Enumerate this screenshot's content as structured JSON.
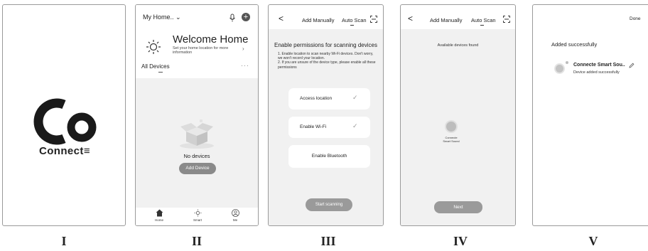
{
  "step_labels": [
    "I",
    "II",
    "III",
    "IV",
    "V"
  ],
  "splash": {
    "logo_letters": "Co",
    "brand": "Connect≡"
  },
  "home": {
    "home_selector": "My Home.. ⌄",
    "add_symbol": "+",
    "welcome_title": "Welcome Home",
    "welcome_sub": "Set your home location for more information",
    "chevron": "›",
    "all_devices": "All Devices",
    "more": "···",
    "no_devices": "No devices",
    "add_device_button": "Add Device",
    "nav": [
      {
        "label": "Home",
        "icon": "home-icon"
      },
      {
        "label": "Smart",
        "icon": "sun-icon"
      },
      {
        "label": "Me",
        "icon": "user-icon"
      }
    ]
  },
  "permissions": {
    "back": "<",
    "tab_manual": "Add Manually",
    "tab_auto": "Auto Scan",
    "title": "Enable permissions for scanning devices",
    "instruction_1": "1. Enable location to scan nearby Wi-Fi devices. Don't worry, we won't record your location.",
    "instruction_2": "2. If you are unsure of the device type, please enable all these permissions",
    "items": [
      {
        "label": "Access location",
        "check": "✓"
      },
      {
        "label": "Enable Wi-Fi",
        "check": "✓"
      },
      {
        "label": "Enable Bluetooth",
        "check": ""
      }
    ],
    "start_button": "Start scanning"
  },
  "scan": {
    "back": "<",
    "tab_manual": "Add Manually",
    "tab_auto": "Auto Scan",
    "available": "Available devices found",
    "device_line1": "Connecte",
    "device_line2": "Smart Sound",
    "next_button": "Next"
  },
  "done": {
    "done_button": "Done",
    "added": "Added successfully",
    "device_name": "Connecte Smart Sou..",
    "device_status": "Device added successfully"
  },
  "colors": {
    "button_gray": "#8a8a8a",
    "background_gray": "#f1f1f1"
  }
}
